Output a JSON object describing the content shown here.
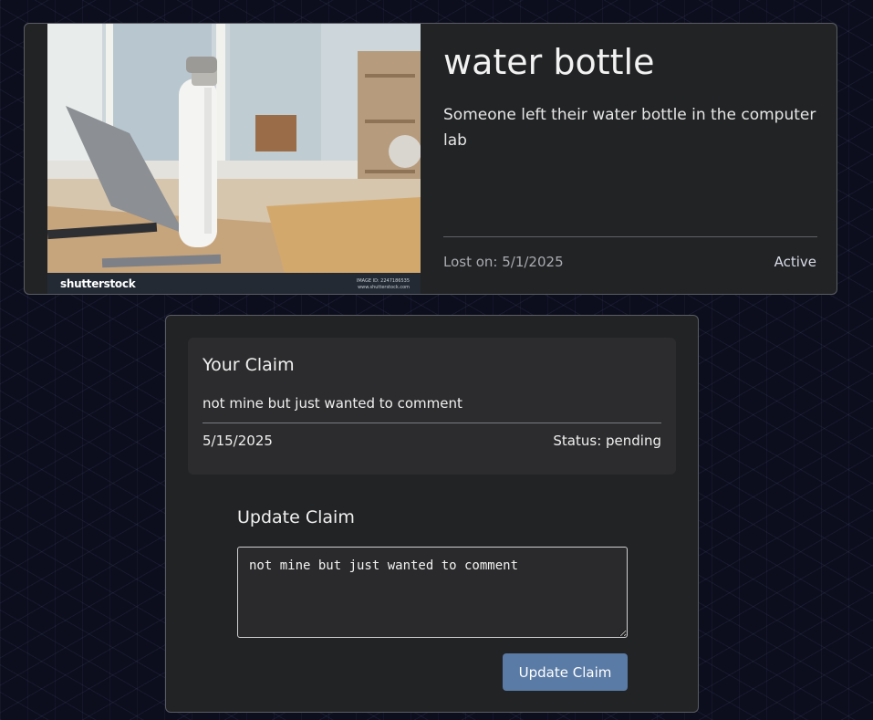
{
  "item": {
    "title": "water bottle",
    "description": "Someone left their water bottle in the computer lab",
    "lost_on": "Lost on: 5/1/2025",
    "status": "Active",
    "photo": {
      "brand_logo": "shutterstock",
      "image_id": "IMAGE ID: 2247186535",
      "site": "www.shutterstock.com"
    }
  },
  "your_claim": {
    "heading": "Your Claim",
    "text": "not mine but just wanted to comment",
    "date": "5/15/2025",
    "status": "Status: pending"
  },
  "update_claim": {
    "heading": "Update Claim",
    "textarea_value": "not mine but just wanted to comment",
    "button_label": "Update Claim"
  },
  "colors": {
    "background": "#0c0e1e",
    "card": "#222325",
    "inner_card": "#2c2c2e",
    "button": "#5a7ba5"
  }
}
